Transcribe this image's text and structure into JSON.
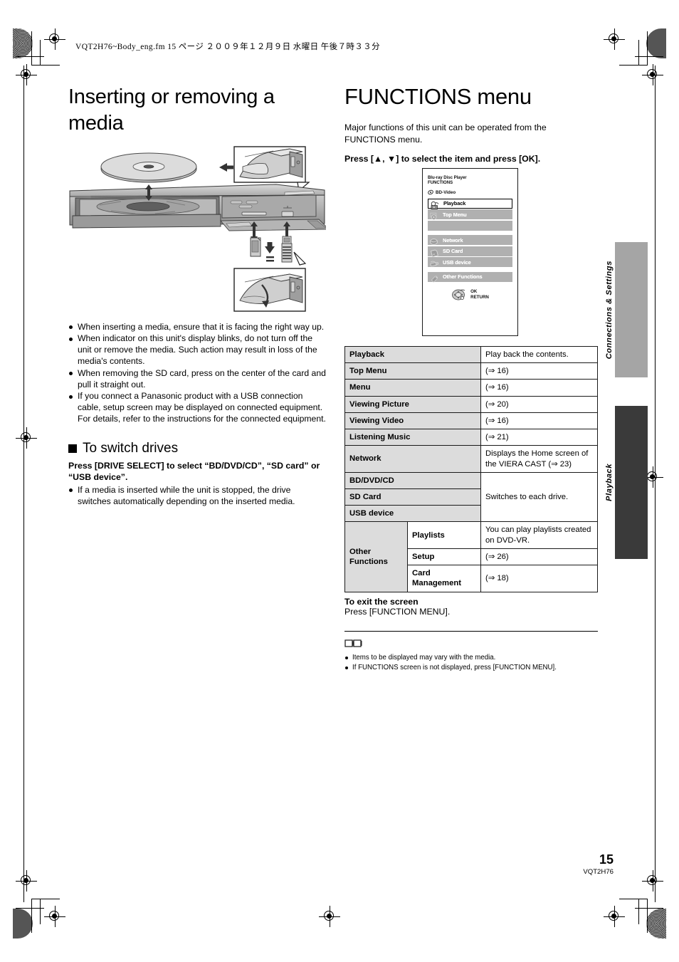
{
  "page": {
    "header_line": "VQT2H76~Body_eng.fm   15 ページ   ２００９年１２月９日   水曜日   午後７時３３分",
    "number": "15",
    "doc_code": "VQT2H76"
  },
  "left_column": {
    "title": "Inserting or removing a media",
    "illustration_name": "blu-ray-player-media-insertion-diagram",
    "bullets": [
      "When inserting a media, ensure that it is facing the right way up.",
      "When indicator on this unit's display blinks, do not turn off the unit or remove the media. Such action may result in loss of the media's contents.",
      "When removing the SD card, press on the center of the card and pull it straight out.",
      "If you connect a Panasonic product with a USB connection cable, setup screen may be displayed on connected equipment. For details, refer to the instructions for the connected equipment."
    ],
    "subsection": {
      "heading": "To switch drives",
      "instruction": "Press [DRIVE SELECT] to select “BD/DVD/CD”, “SD card” or “USB device”.",
      "bullets": [
        "If a media is inserted while the unit is stopped, the drive switches automatically depending on the inserted media."
      ]
    }
  },
  "right_column": {
    "title": "FUNCTIONS menu",
    "intro": "Major functions of this unit can be operated from the FUNCTIONS menu.",
    "instruction": "Press [▲, ▼] to select the item and press [OK].",
    "screen": {
      "title_line1": "Blu-ray Disc Player",
      "title_line2": "FUNCTIONS",
      "media_label": "BD-Video",
      "items": [
        {
          "label": "Playback",
          "selected": true,
          "icon": "playback-icon"
        },
        {
          "label": "Top Menu",
          "selected": false,
          "icon": "top-menu-disc-icon"
        },
        {
          "label": "",
          "selected": false,
          "icon": "blank-icon"
        },
        {
          "label": "Network",
          "selected": false,
          "icon": "network-globe-icon"
        },
        {
          "label": "SD Card",
          "selected": false,
          "icon": "sd-card-icon"
        },
        {
          "label": "USB device",
          "selected": false,
          "icon": "usb-device-icon"
        },
        {
          "label": "Other Functions",
          "selected": false,
          "icon": "other-functions-wrench-icon"
        }
      ],
      "ok_label": "OK",
      "return_label": "RETURN"
    },
    "table": {
      "rows": [
        {
          "key": "Playback",
          "sub": null,
          "desc": "Play back the contents.",
          "rowspan_desc": 1
        },
        {
          "key": "Top Menu",
          "sub": null,
          "desc": "(⇒ 16)",
          "rowspan_desc": 1
        },
        {
          "key": "Menu",
          "sub": null,
          "desc": "(⇒ 16)",
          "rowspan_desc": 1
        },
        {
          "key": "Viewing Picture",
          "sub": null,
          "desc": "(⇒ 20)",
          "rowspan_desc": 1
        },
        {
          "key": "Viewing Video",
          "sub": null,
          "desc": "(⇒ 16)",
          "rowspan_desc": 1
        },
        {
          "key": "Listening Music",
          "sub": null,
          "desc": "(⇒ 21)",
          "rowspan_desc": 1
        },
        {
          "key": "Network",
          "sub": null,
          "desc": "Displays the Home screen of the VIERA CAST (⇒ 23)",
          "rowspan_desc": 1
        },
        {
          "key": "BD/DVD/CD",
          "sub": null,
          "desc": "Switches to each drive.",
          "rowspan_desc": 3
        },
        {
          "key": "SD Card",
          "sub": null,
          "desc": null,
          "rowspan_desc": 0
        },
        {
          "key": "USB device",
          "sub": null,
          "desc": null,
          "rowspan_desc": 0
        }
      ],
      "other_functions_group": "Other Functions",
      "other_functions_rows": [
        {
          "sub": "Playlists",
          "desc": "You can play playlists created on DVD-VR."
        },
        {
          "sub": "Setup",
          "desc": "(⇒ 26)"
        },
        {
          "sub": "Card Management",
          "desc": "(⇒ 18)"
        }
      ]
    },
    "exit": {
      "title": "To exit the screen",
      "body": "Press [FUNCTION MENU]."
    },
    "notes": [
      "Items to be displayed may vary with the media.",
      "If FUNCTIONS screen is not displayed, press [FUNCTION MENU]."
    ]
  },
  "side_tabs": [
    {
      "label": "Connections & Settings",
      "color": "#a5a5a5"
    },
    {
      "label": "Playback",
      "color": "#3a3a3a"
    }
  ]
}
